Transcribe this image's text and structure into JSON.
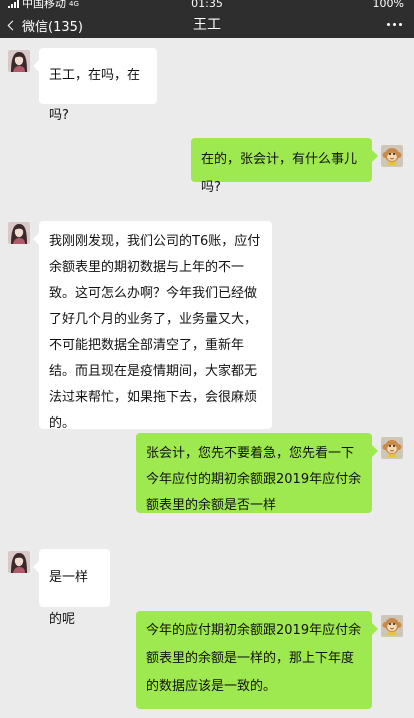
{
  "status_bar": {
    "carrier": "中国移动",
    "network": "4G",
    "time": "01:35",
    "battery": "100%"
  },
  "nav": {
    "back_label": "微信(135)",
    "title": "王工"
  },
  "messages": [
    {
      "sender": "王工",
      "side": "left",
      "text": "王工，在吗，在吗?"
    },
    {
      "sender": "me",
      "side": "right",
      "text": "在的，张会计，有什么事儿吗?"
    },
    {
      "sender": "王工",
      "side": "left",
      "text": "我刚刚发现，我们公司的T6账，应付余额表里的期初数据与上年的不一致。这可怎么办啊？今年我们已经做了好几个月的业务了，业务量又大，不可能把数据全部清空了，重新年结。而且现在是疫情期间，大家都无法过来帮忙，如果拖下去，会很麻烦的。"
    },
    {
      "sender": "me",
      "side": "right",
      "text": "张会计，您先不要着急，您先看一下今年应付的期初余额跟2019年应付余额表里的余额是否一样"
    },
    {
      "sender": "王工",
      "side": "left",
      "text": "是一样的呢"
    },
    {
      "sender": "me",
      "side": "right",
      "text": "今年的应付期初余额跟2019年应付余额表里的余额是一样的，那上下年度的数据应该是一致的。"
    }
  ],
  "colors": {
    "nav_bg": "#2e2e2e",
    "chat_bg": "#ebebeb",
    "bubble_left": "#ffffff",
    "bubble_right": "#9ee850"
  },
  "icons": {
    "back": "chevron-left-icon",
    "more": "more-dots-icon",
    "contact_avatar": "girl-photo-avatar",
    "my_avatar": "monkey-avatar"
  }
}
